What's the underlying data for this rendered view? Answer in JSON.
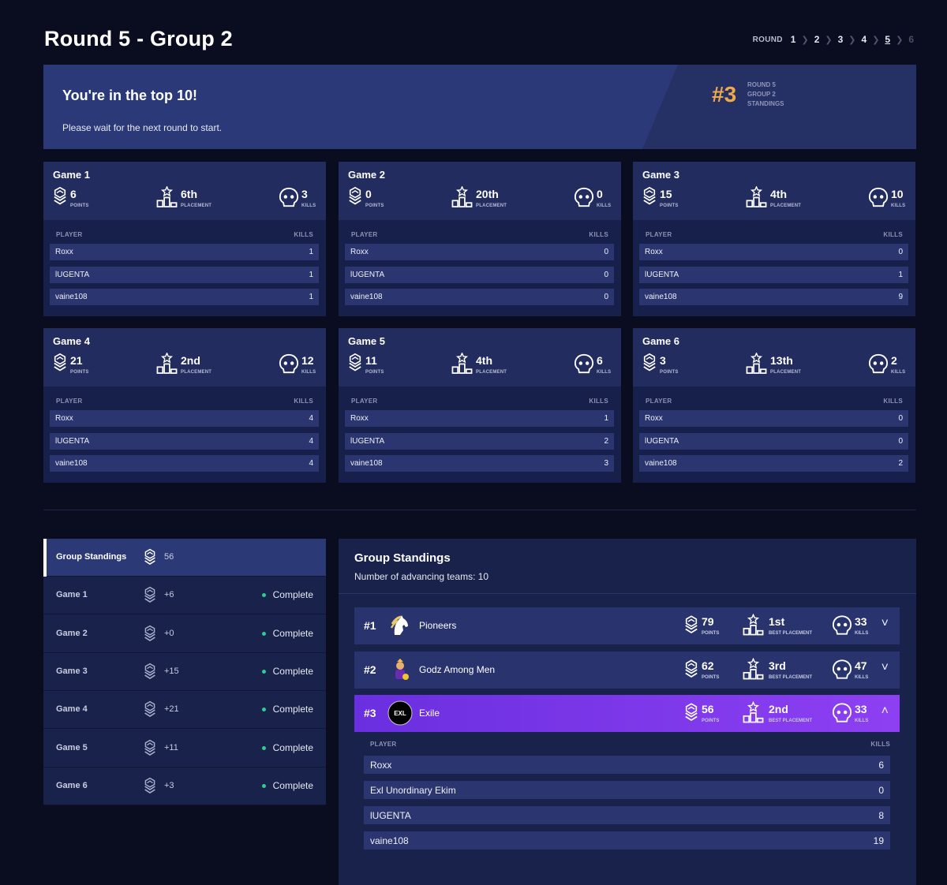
{
  "page": {
    "title": "Round 5 - Group 2"
  },
  "round_nav": {
    "label": "ROUND",
    "rounds": [
      "1",
      "2",
      "3",
      "4",
      "5",
      "6"
    ],
    "active": "5"
  },
  "banner": {
    "title": "You're in the top 10!",
    "message": "Please wait for the next round to start.",
    "rank": "#3",
    "rank_caption": [
      "ROUND 5",
      "GROUP 2",
      "STANDINGS"
    ]
  },
  "labels": {
    "points": "POINTS",
    "placement": "PLACEMENT",
    "kills": "KILLS",
    "player": "PLAYER",
    "best_placement": "BEST PLACEMENT"
  },
  "games": [
    {
      "title": "Game 1",
      "points": "6",
      "placement": "6th",
      "kills": "3",
      "players": [
        {
          "name": "Roxx",
          "kills": "1"
        },
        {
          "name": "lUGENTA",
          "kills": "1"
        },
        {
          "name": "vaine108",
          "kills": "1"
        }
      ]
    },
    {
      "title": "Game 2",
      "points": "0",
      "placement": "20th",
      "kills": "0",
      "players": [
        {
          "name": "Roxx",
          "kills": "0"
        },
        {
          "name": "lUGENTA",
          "kills": "0"
        },
        {
          "name": "vaine108",
          "kills": "0"
        }
      ]
    },
    {
      "title": "Game 3",
      "points": "15",
      "placement": "4th",
      "kills": "10",
      "players": [
        {
          "name": "Roxx",
          "kills": "0"
        },
        {
          "name": "lUGENTA",
          "kills": "1"
        },
        {
          "name": "vaine108",
          "kills": "9"
        }
      ]
    },
    {
      "title": "Game 4",
      "points": "21",
      "placement": "2nd",
      "kills": "12",
      "players": [
        {
          "name": "Roxx",
          "kills": "4"
        },
        {
          "name": "lUGENTA",
          "kills": "4"
        },
        {
          "name": "vaine108",
          "kills": "4"
        }
      ]
    },
    {
      "title": "Game 5",
      "points": "11",
      "placement": "4th",
      "kills": "6",
      "players": [
        {
          "name": "Roxx",
          "kills": "1"
        },
        {
          "name": "lUGENTA",
          "kills": "2"
        },
        {
          "name": "vaine108",
          "kills": "3"
        }
      ]
    },
    {
      "title": "Game 6",
      "points": "3",
      "placement": "13th",
      "kills": "2",
      "players": [
        {
          "name": "Roxx",
          "kills": "0"
        },
        {
          "name": "lUGENTA",
          "kills": "0"
        },
        {
          "name": "vaine108",
          "kills": "2"
        }
      ]
    }
  ],
  "side_list": [
    {
      "name": "Group Standings",
      "points": "56",
      "status": ""
    },
    {
      "name": "Game 1",
      "points": "+6",
      "status": "Complete"
    },
    {
      "name": "Game 2",
      "points": "+0",
      "status": "Complete"
    },
    {
      "name": "Game 3",
      "points": "+15",
      "status": "Complete"
    },
    {
      "name": "Game 4",
      "points": "+21",
      "status": "Complete"
    },
    {
      "name": "Game 5",
      "points": "+11",
      "status": "Complete"
    },
    {
      "name": "Game 6",
      "points": "+3",
      "status": "Complete"
    }
  ],
  "standings": {
    "title": "Group Standings",
    "subtitle": "Number of advancing teams: 10",
    "teams": [
      {
        "rank": "#1",
        "name": "Pioneers",
        "points": "79",
        "best_placement": "1st",
        "kills": "33",
        "logo": "horse-logo-icon",
        "chevron": "chevron-down-icon"
      },
      {
        "rank": "#2",
        "name": "Godz Among Men",
        "points": "62",
        "best_placement": "3rd",
        "kills": "47",
        "logo": "character-logo-icon",
        "chevron": "chevron-down-icon"
      },
      {
        "rank": "#3",
        "name": "Exile",
        "points": "56",
        "best_placement": "2nd",
        "kills": "33",
        "logo": "exile-logo-icon",
        "chevron": "chevron-up-icon"
      }
    ],
    "expanded_players": [
      {
        "name": "Roxx",
        "kills": "6"
      },
      {
        "name": "Exl Unordinary Ekim",
        "kills": "0"
      },
      {
        "name": "lUGENTA",
        "kills": "8"
      },
      {
        "name": "vaine108",
        "kills": "19"
      }
    ]
  },
  "colors": {
    "background": "#090d1f",
    "accent_rank": "#f0a94a",
    "selected_team": "#7b37ea",
    "complete_dot": "#2ecc8f"
  }
}
